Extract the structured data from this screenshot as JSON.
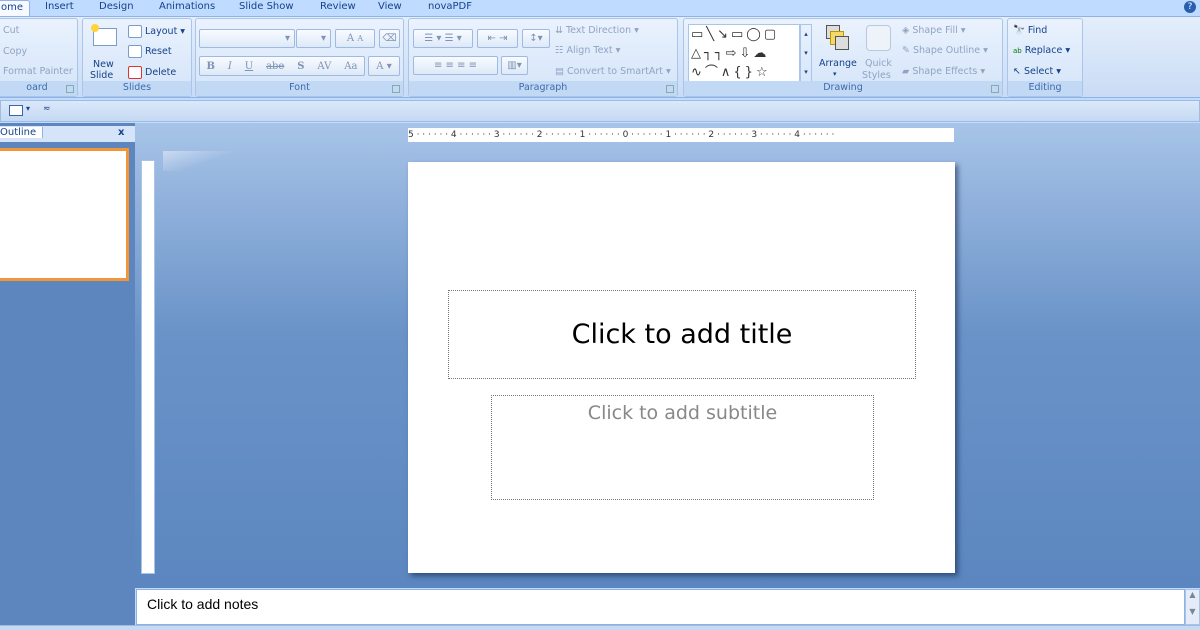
{
  "tabs": [
    {
      "label": "ome",
      "active": true
    },
    {
      "label": "Insert"
    },
    {
      "label": "Design"
    },
    {
      "label": "Animations"
    },
    {
      "label": "Slide Show"
    },
    {
      "label": "Review"
    },
    {
      "label": "View"
    },
    {
      "label": "novaPDF"
    }
  ],
  "ribbon": {
    "clipboard": {
      "label": "oard",
      "cut": "Cut",
      "copy": "Copy",
      "format_painter": "Format Painter"
    },
    "slides": {
      "label": "Slides",
      "new_slide_1": "New",
      "new_slide_2": "Slide",
      "layout": "Layout",
      "reset": "Reset",
      "delete": "Delete"
    },
    "font": {
      "label": "Font",
      "bold": "B",
      "italic": "I",
      "underline": "U",
      "strike": "abe",
      "shadow": "S",
      "spacing": "AV",
      "case": "Aa",
      "color": "A",
      "grow": "A",
      "shrink": "A"
    },
    "paragraph": {
      "label": "Paragraph",
      "text_direction": "Text Direction",
      "align_text": "Align Text",
      "convert_smartart": "Convert to SmartArt"
    },
    "drawing": {
      "label": "Drawing",
      "arrange": "Arrange",
      "quick_styles_1": "Quick",
      "quick_styles_2": "Styles",
      "shape_fill": "Shape Fill",
      "shape_outline": "Shape Outline",
      "shape_effects": "Shape Effects"
    },
    "editing": {
      "label": "Editing",
      "find": "Find",
      "replace": "Replace",
      "select": "Select"
    }
  },
  "left_pane": {
    "tab": "Outline",
    "close": "x"
  },
  "ruler": {
    "h": "5 · · · · · · 4 · · · · · · 3 · · · · · · 2 · · · · · · 1 · · · · · · 0 · · · · · · 1 · · · · · · 2 · · · · · · 3 · · · · · · 4 · · · · · ·"
  },
  "slide": {
    "title_placeholder": "Click to add title",
    "subtitle_placeholder": "Click to add subtitle"
  },
  "notes": {
    "placeholder": "Click to add notes"
  },
  "colors": {
    "ribbon_bg": "#dbe8f9",
    "workspace": "#6a93c8",
    "thumbnail_selected": "#f29536"
  }
}
